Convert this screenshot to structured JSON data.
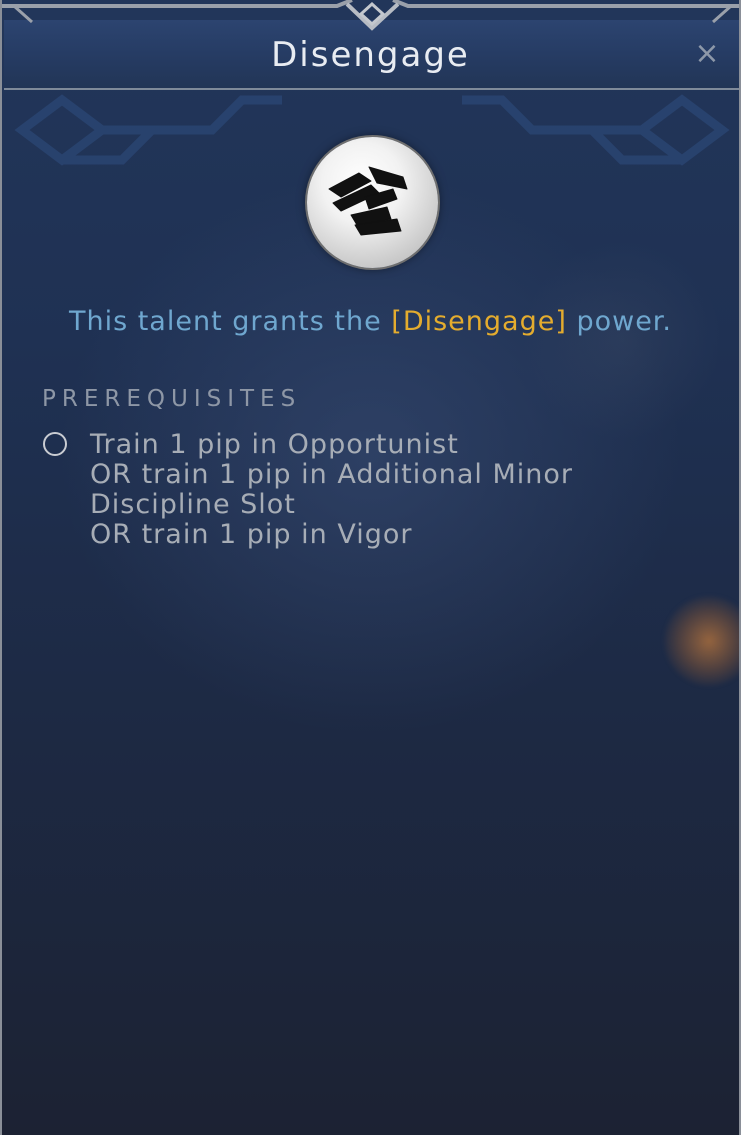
{
  "dialog": {
    "title": "Disengage",
    "close_glyph": "×",
    "icon_name": "disengage-power-icon"
  },
  "description": {
    "prefix": "This talent grants the ",
    "power": "[Disengage]",
    "suffix": " power."
  },
  "prerequisites": {
    "heading": "PREREQUISITES",
    "items": [
      {
        "checked": false,
        "lines": [
          "Train 1 pip in Opportunist",
          "OR train 1 pip in Additional Minor",
          "Discipline Slot",
          "OR train 1 pip in Vigor"
        ]
      }
    ]
  },
  "colors": {
    "description_text": "#6fa7cf",
    "power_highlight": "#e4ac2e",
    "prereq_text": "#a7adb6",
    "title_text": "#e8ecf2"
  }
}
